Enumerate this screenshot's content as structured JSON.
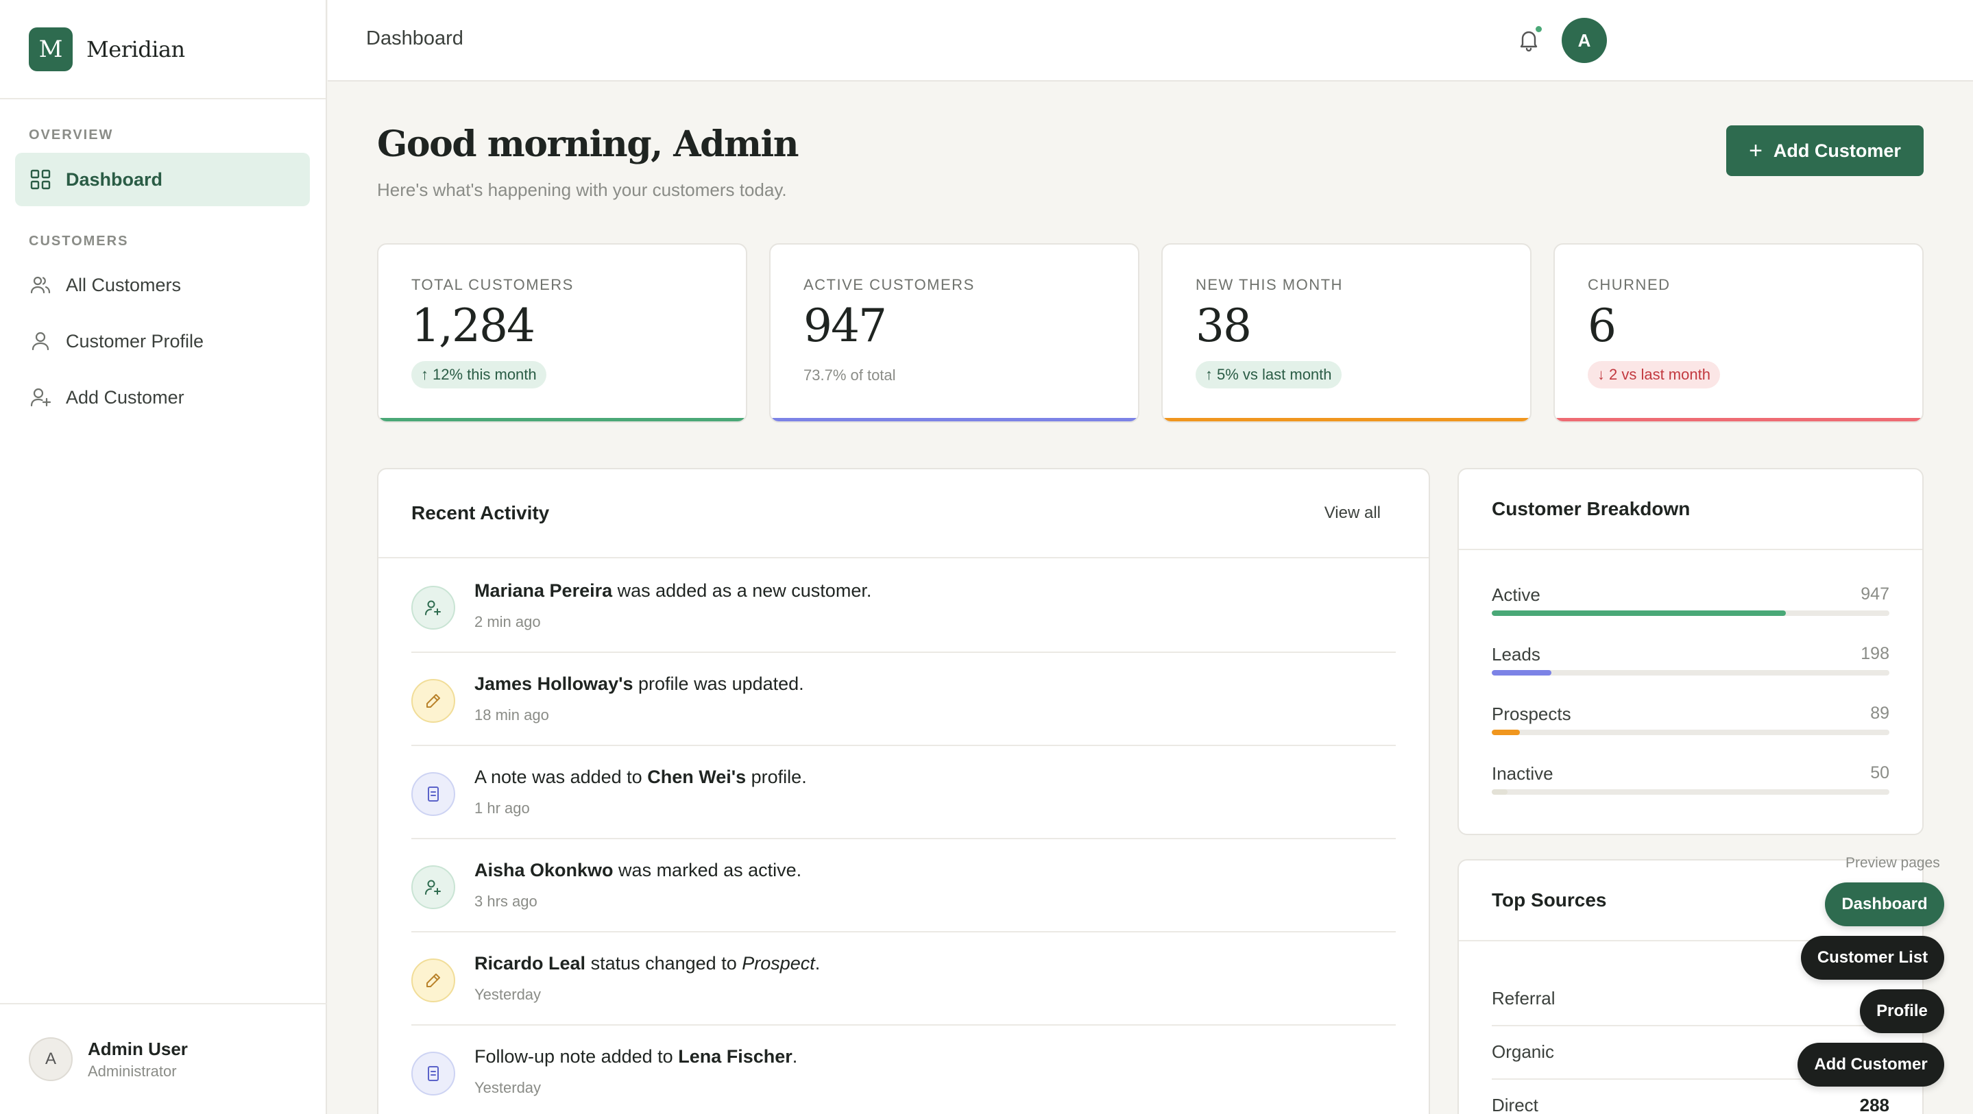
{
  "brand": {
    "logo_letter": "M",
    "name": "Meridian"
  },
  "sidebar": {
    "sections": [
      {
        "title": "OVERVIEW"
      },
      {
        "title": "CUSTOMERS"
      }
    ],
    "items": [
      {
        "label": "Dashboard",
        "icon": "grid-icon",
        "active": true
      },
      {
        "label": "All Customers",
        "icon": "users-icon"
      },
      {
        "label": "Customer Profile",
        "icon": "user-icon"
      },
      {
        "label": "Add Customer",
        "icon": "user-plus-icon"
      }
    ],
    "user": {
      "initial": "A",
      "name": "Admin User",
      "role": "Administrator"
    }
  },
  "topbar": {
    "title": "Dashboard",
    "avatar_initial": "A"
  },
  "header": {
    "greeting": "Good morning, Admin",
    "subtitle": "Here's what's happening with your customers today.",
    "add_button": "Add Customer"
  },
  "stats": [
    {
      "label": "TOTAL CUSTOMERS",
      "value": "1,284",
      "note": "12% this month",
      "trend": "up",
      "color": "#4aa877"
    },
    {
      "label": "ACTIVE CUSTOMERS",
      "value": "947",
      "note": "73.7% of total",
      "trend": "none",
      "color": "#7c83e6"
    },
    {
      "label": "NEW THIS MONTH",
      "value": "38",
      "note": "5% vs last month",
      "trend": "up",
      "color": "#f0961e"
    },
    {
      "label": "CHURNED",
      "value": "6",
      "note": "2 vs last month",
      "trend": "down",
      "color": "#ee6b73"
    }
  ],
  "activity": {
    "title": "Recent Activity",
    "view_all": "View all",
    "items": [
      {
        "name": "Mariana Pereira",
        "rest": " was added as a new customer.",
        "time": "2 min ago",
        "icon": "user-plus-icon",
        "tone": "green"
      },
      {
        "name": "James Holloway's",
        "rest": " profile was updated.",
        "time": "18 min ago",
        "icon": "pencil-icon",
        "tone": "yellow"
      },
      {
        "pre": "A note was added to ",
        "name": "Chen Wei's",
        "rest": " profile.",
        "time": "1 hr ago",
        "icon": "note-icon",
        "tone": "blue"
      },
      {
        "name": "Aisha Okonkwo",
        "rest": " was marked as active.",
        "time": "3 hrs ago",
        "icon": "user-plus-icon",
        "tone": "green"
      },
      {
        "name": "Ricardo Leal",
        "rest": " status changed to ",
        "em": "Prospect",
        "tail": ".",
        "time": "Yesterday",
        "icon": "pencil-icon",
        "tone": "yellow"
      },
      {
        "pre": "Follow-up note added to ",
        "name": "Lena Fischer",
        "rest": ".",
        "time": "Yesterday",
        "icon": "note-icon",
        "tone": "blue"
      }
    ]
  },
  "breakdown": {
    "title": "Customer Breakdown",
    "rows": [
      {
        "label": "Active",
        "value": "947",
        "fraction": 0.74,
        "color": "#4aa877"
      },
      {
        "label": "Leads",
        "value": "198",
        "fraction": 0.15,
        "color": "#7c83e6"
      },
      {
        "label": "Prospects",
        "value": "89",
        "fraction": 0.07,
        "color": "#f0961e"
      },
      {
        "label": "Inactive",
        "value": "50",
        "fraction": 0.04,
        "color": "#e3e1d6"
      }
    ]
  },
  "sources": {
    "title": "Top Sources",
    "rows": [
      {
        "label": "Referral",
        "value": ""
      },
      {
        "label": "Organic",
        "value": ""
      },
      {
        "label": "Direct",
        "value": "288"
      }
    ]
  },
  "preview": {
    "label": "Preview pages",
    "buttons": [
      "Dashboard",
      "Customer List",
      "Profile",
      "Add Customer"
    ]
  }
}
